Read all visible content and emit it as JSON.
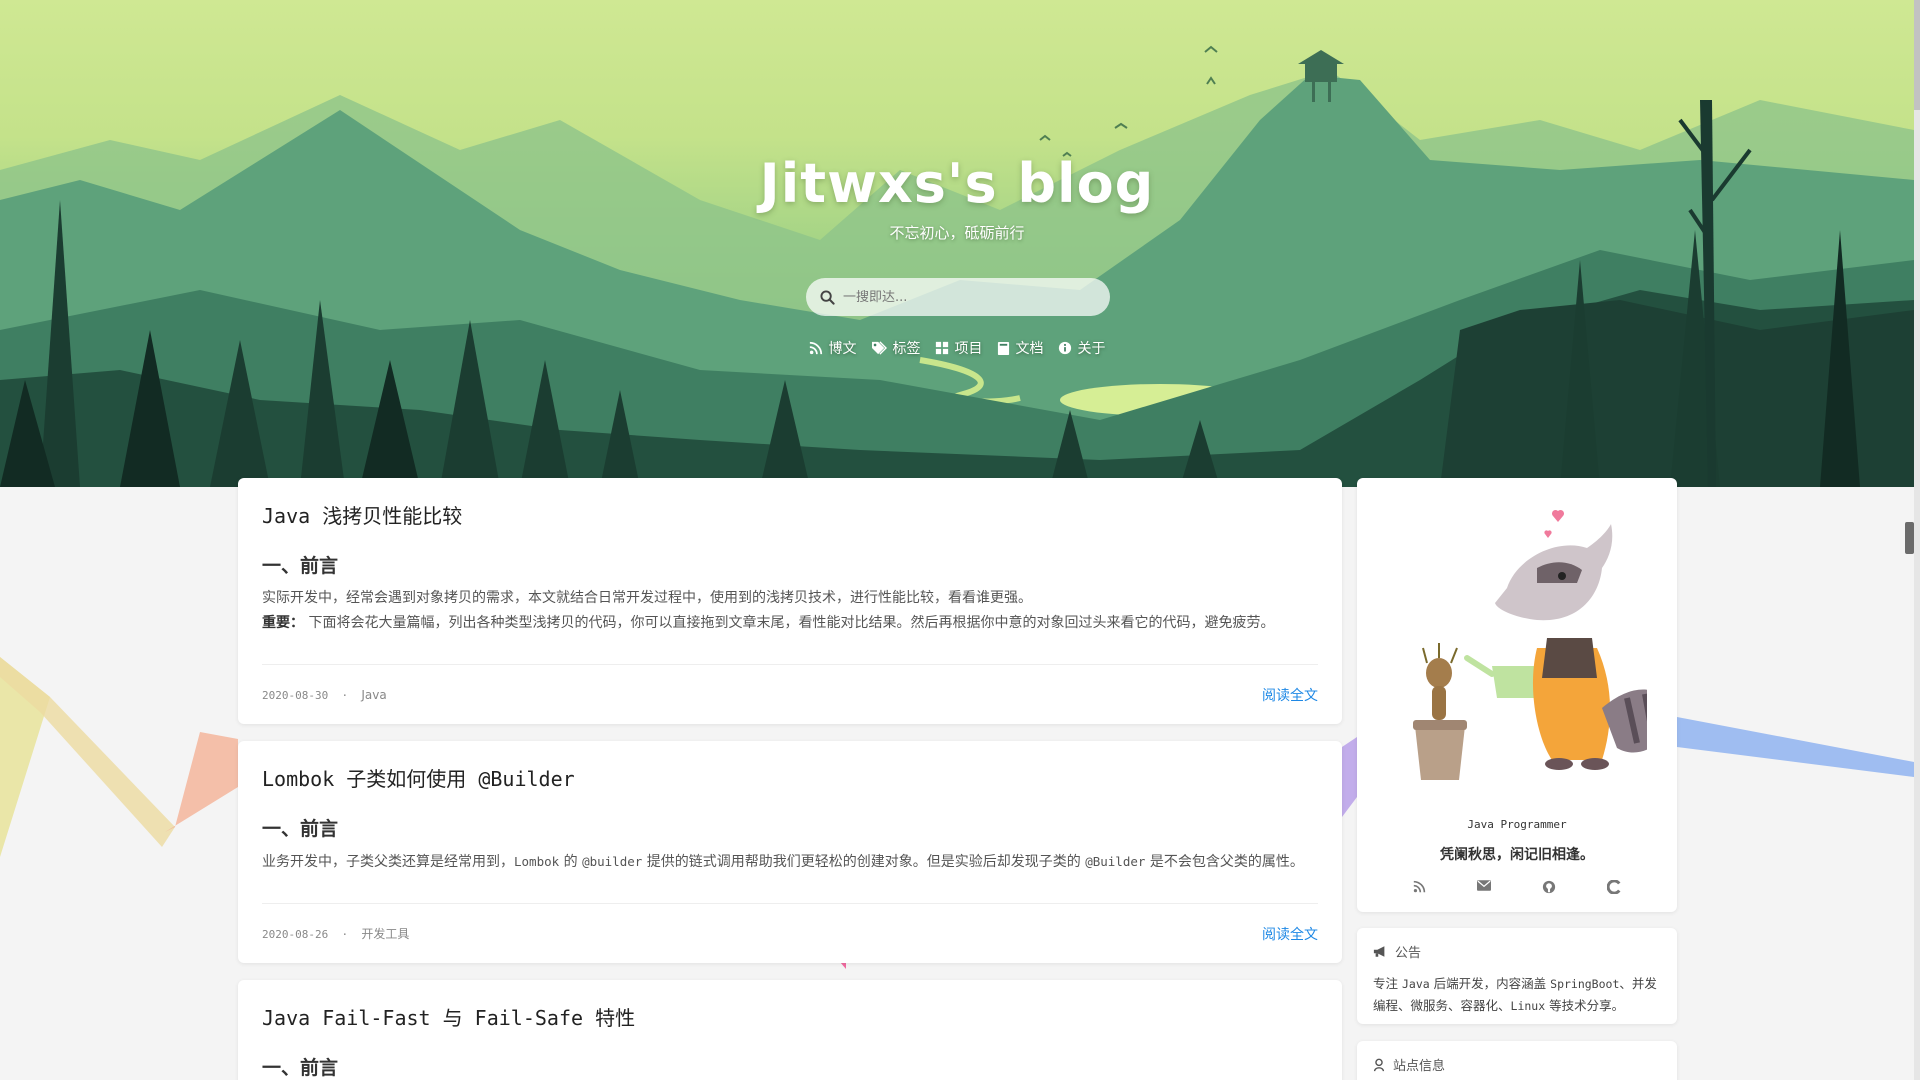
{
  "hero": {
    "title": "Jitwxs's blog",
    "subtitle": "不忘初心，砥砺前行",
    "search_placeholder": "一搜即达..."
  },
  "nav": [
    {
      "label": "博文",
      "icon": "rss-icon"
    },
    {
      "label": "标签",
      "icon": "tags-icon"
    },
    {
      "label": "项目",
      "icon": "grid-icon"
    },
    {
      "label": "文档",
      "icon": "book-icon"
    },
    {
      "label": "关于",
      "icon": "info-icon"
    }
  ],
  "posts": [
    {
      "title": "Java 浅拷贝性能比较",
      "heading": "一、前言",
      "para1": "实际开发中，经常会遇到对象拷贝的需求，本文就结合日常开发过程中，使用到的浅拷贝技术，进行性能比较，看看谁更强。",
      "para2_label": "重要：",
      "para2": " 下面将会花大量篇幅，列出各种类型浅拷贝的代码，你可以直接拖到文章末尾，看性能对比结果。然后再根据你中意的对象回过头来看它的代码，避免疲劳。",
      "date": "2020-08-30",
      "category": "Java",
      "read_more": "阅读全文"
    },
    {
      "title": "Lombok 子类如何使用 @Builder",
      "heading": "一、前言",
      "para_a": "业务开发中，子类父类还算是经常用到，",
      "code_a": "Lombok",
      "para_b": " 的 ",
      "code_b": "@builder",
      "para_c": " 提供的链式调用帮助我们更轻松的创建对象。但是实验后却发现子类的 ",
      "code_c": "@Builder",
      "para_d": " 是不会包含父类的属性。",
      "date": "2020-08-26",
      "category": "开发工具",
      "read_more": "阅读全文"
    },
    {
      "title": "Java Fail-Fast 与 Fail-Safe 特性",
      "heading": "一、前言"
    }
  ],
  "meta_separator": "·",
  "sidebar": {
    "role": "Java Programmer",
    "motto": "凭阑秋思，闲记旧相逢。",
    "social_icons": [
      "rss-icon",
      "mail-icon",
      "github-icon",
      "csdn-icon"
    ],
    "notice": {
      "title": "公告",
      "text_a": "专注 ",
      "code_a": "Java",
      "text_b": " 后端开发，内容涵盖 ",
      "code_b": "SpringBoot",
      "text_c": "、并发编程、微服务、容器化、",
      "code_c": "Linux",
      "text_d": " 等技术分享。"
    },
    "site_info_title": "站点信息"
  },
  "colors": {
    "accent": "#1e88e5",
    "hero_sky": "#cfe893",
    "page_bg": "#f4f4f4"
  }
}
